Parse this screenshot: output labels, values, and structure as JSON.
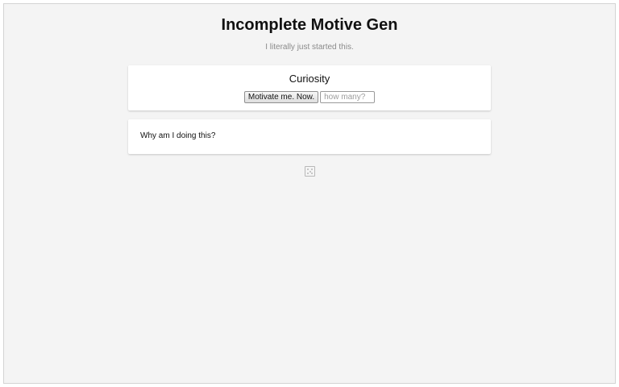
{
  "header": {
    "title": "Incomplete Motive Gen",
    "subtitle": "I literally just started this."
  },
  "generator": {
    "category": "Curiosity",
    "button_label": "Motivate me. Now.",
    "count_placeholder": "how many?",
    "count_value": ""
  },
  "output": {
    "text": "Why am I doing this?"
  },
  "icons": {
    "randomize": "dice-icon"
  },
  "colors": {
    "page_background": "#f4f4f4",
    "card_background": "#ffffff",
    "subtitle_text": "#8a8a8a",
    "icon_gray": "#b8b8b8"
  }
}
